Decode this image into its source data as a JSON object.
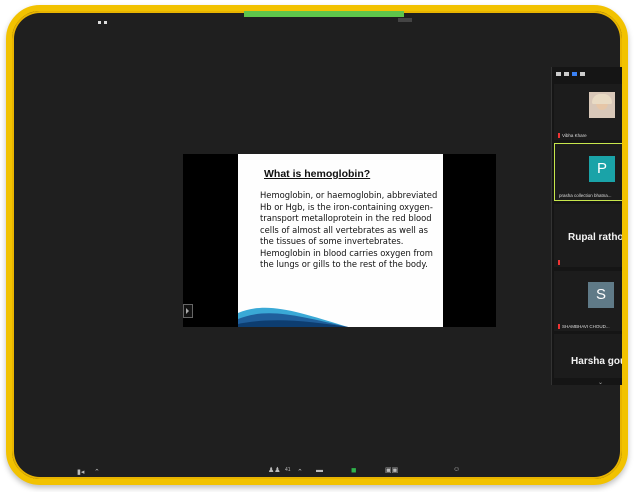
{
  "meeting": {
    "slide": {
      "title": "What is hemoglobin?",
      "body": "Hemoglobin, or haemoglobin, abbreviated Hb or Hgb, is the iron-containing oxygen-transport metalloprotein in the red blood cells of almost all vertebrates as well as the tissues of some invertebrates. Hemoglobin in blood carries oxygen from the lungs or gills to the rest of the body."
    },
    "participants": [
      {
        "name": "Vibha Khare",
        "type": "photo"
      },
      {
        "name": "prasha collection bhatna...",
        "type": "avatar",
        "initial": "P",
        "color": "#1aa3a8"
      },
      {
        "name": "Rupal rathore",
        "type": "name"
      },
      {
        "name": "SHAMBHAVI CHOUD...",
        "type": "avatar",
        "initial": "S",
        "color": "#5f7a87"
      },
      {
        "name": "Harsha gour",
        "type": "name"
      }
    ],
    "toolbar": {
      "participants_count": "41"
    }
  },
  "colors": {
    "frame": "#f2c200",
    "background": "#1f1f1f",
    "active_speaker": "#c7e64c"
  }
}
